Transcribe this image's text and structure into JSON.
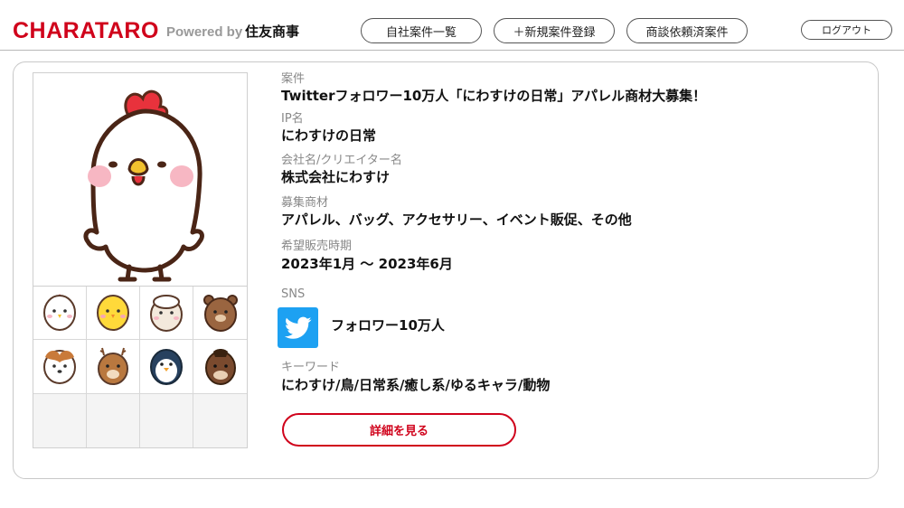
{
  "colors": {
    "brand": "#d0021b",
    "twitter": "#1da1f2"
  },
  "header": {
    "logo": "CHARATARO",
    "powered_by": "Powered by",
    "company": "住友商事",
    "nav": [
      "自社案件一覧",
      "＋新規案件登録",
      "商談依頼済案件"
    ],
    "logout": "ログアウト"
  },
  "listing": {
    "main_image": "white-chicken-character",
    "thumbnails": [
      "white-chick-icon",
      "yellow-chick-icon",
      "sheep-icon",
      "bear-icon",
      "dog-icon",
      "deer-icon",
      "penguin-icon",
      "horse-icon",
      "",
      "",
      "",
      ""
    ],
    "fields": {
      "project_label": "案件",
      "project_value": "Twitterフォロワー10万人「にわすけの日常」アパレル商材大募集！",
      "ip_label": "IP名",
      "ip_value": "にわすけの日常",
      "company_label": "会社名/クリエイター名",
      "company_value": "株式会社にわすけ",
      "products_label": "募集商材",
      "products_value": "アパレル、バッグ、アクセサリー、イベント販促、その他",
      "period_label": "希望販売時期",
      "period_value": "2023年1月 ～ 2023年6月",
      "sns_label": "SNS",
      "sns_icon": "twitter-icon",
      "sns_followers": "フォロワー10万人",
      "keywords_label": "キーワード",
      "keywords_value": "にわすけ/鳥/日常系/癒し系/ゆるキャラ/動物"
    },
    "detail_button": "詳細を見る"
  }
}
